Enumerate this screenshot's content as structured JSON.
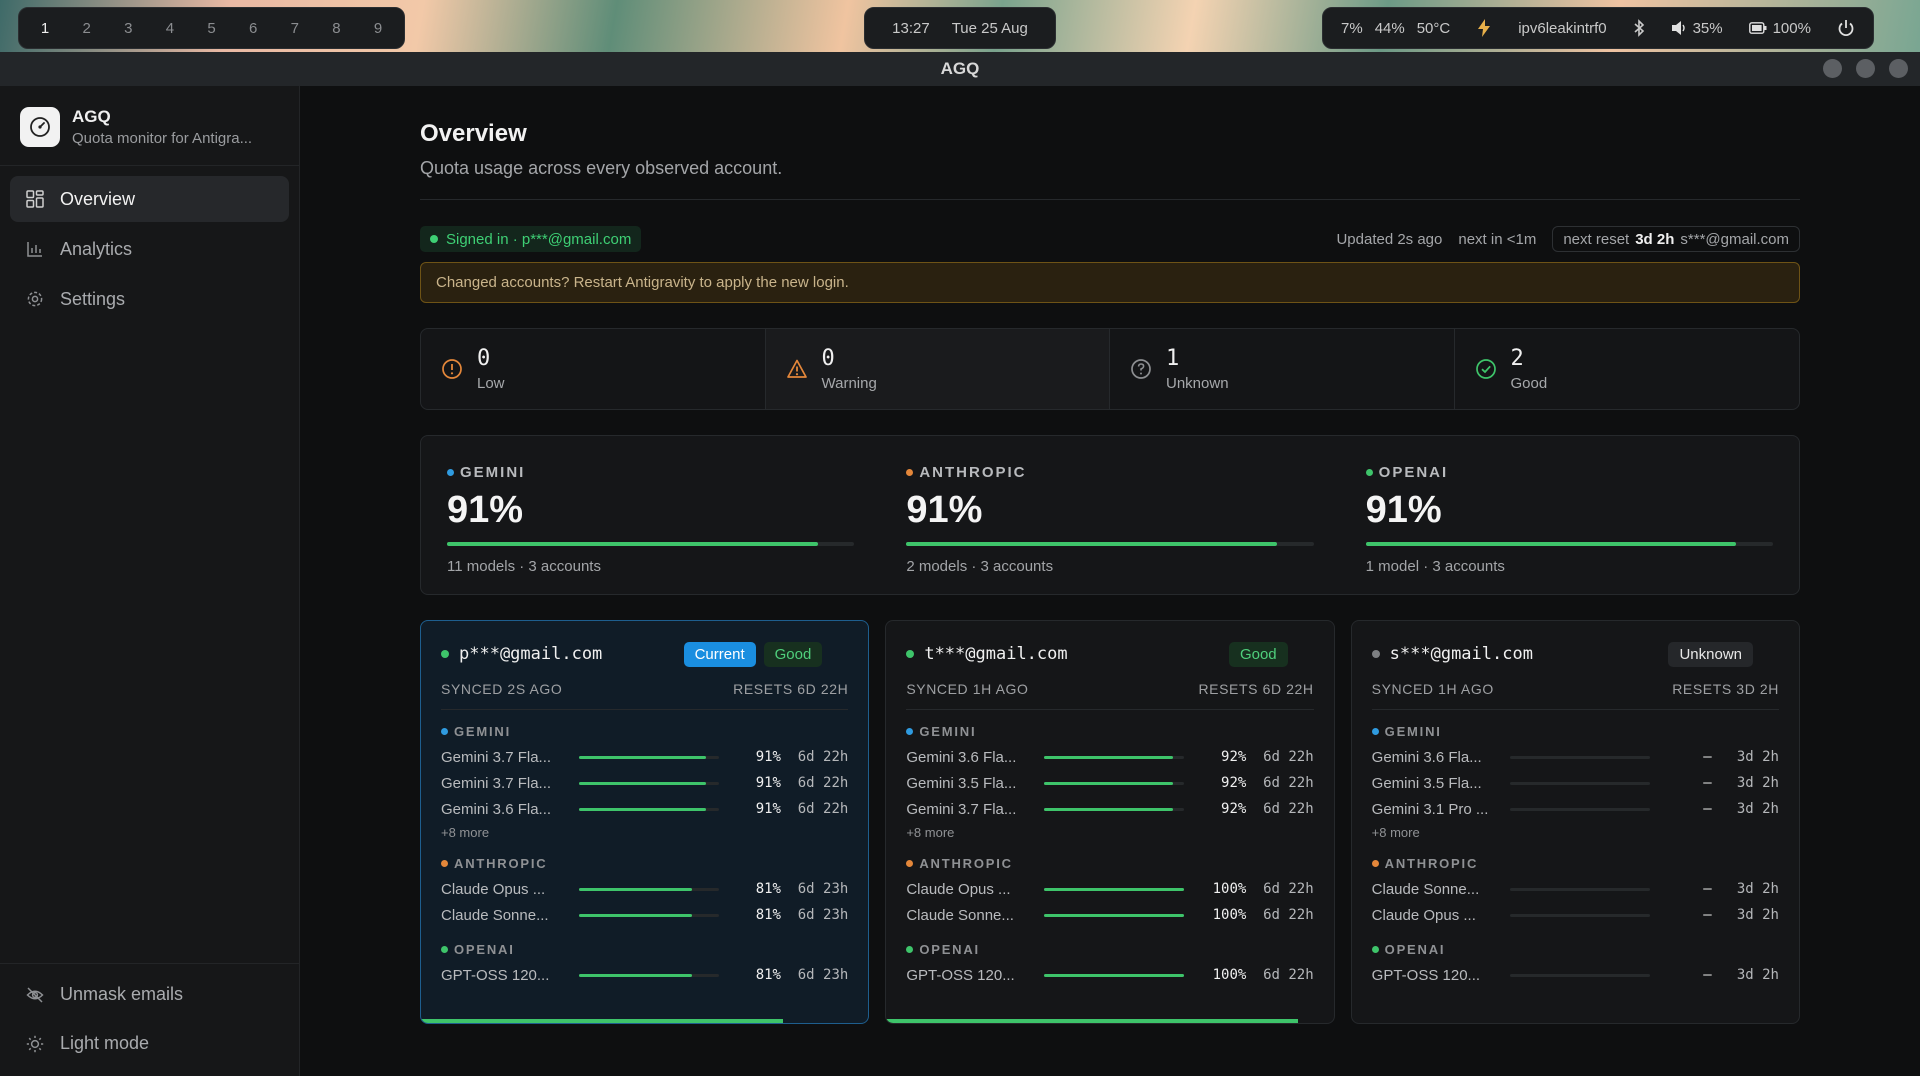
{
  "desktop": {
    "workspaces": [
      "1",
      "2",
      "3",
      "4",
      "5",
      "6",
      "7",
      "8",
      "9"
    ],
    "active_workspace": "1",
    "time": "13:27",
    "date": "Tue 25 Aug",
    "cpu": "7%",
    "mem": "44%",
    "temp": "50°C",
    "network": "ipv6leakintrf0",
    "volume": "35%",
    "battery": "100%"
  },
  "window": {
    "title": "AGQ"
  },
  "sidebar": {
    "app_name": "AGQ",
    "app_sub": "Quota monitor for Antigra...",
    "nav": [
      {
        "label": "Overview",
        "icon": "grid-icon"
      },
      {
        "label": "Analytics",
        "icon": "bar-chart-icon"
      },
      {
        "label": "Settings",
        "icon": "gear-icon"
      }
    ],
    "bottom": [
      {
        "label": "Unmask emails",
        "icon": "eye-off-icon"
      },
      {
        "label": "Light mode",
        "icon": "sun-icon"
      }
    ]
  },
  "header": {
    "title": "Overview",
    "subtitle": "Quota usage across every observed account."
  },
  "status": {
    "signed_in": "Signed in · p***@gmail.com",
    "updated": "Updated 2s ago",
    "next": "next in <1m",
    "next_reset_label": "next reset",
    "next_reset_value": "3d 2h",
    "next_reset_email": "s***@gmail.com"
  },
  "banner": "Changed accounts? Restart Antigravity to apply the new login.",
  "summary": [
    {
      "count": "0",
      "label": "Low",
      "color": "#e4873a"
    },
    {
      "count": "0",
      "label": "Warning",
      "color": "#e4873a"
    },
    {
      "count": "1",
      "label": "Unknown",
      "color": "#8c8e91"
    },
    {
      "count": "2",
      "label": "Good",
      "color": "#3ec46a"
    }
  ],
  "providers": [
    {
      "name": "GEMINI",
      "color": "#2f9be0",
      "pct": "91%",
      "fill": 0.91,
      "meta": "11 models · 3 accounts"
    },
    {
      "name": "ANTHROPIC",
      "color": "#e4873a",
      "pct": "91%",
      "fill": 0.91,
      "meta": "2 models · 3 accounts"
    },
    {
      "name": "OPENAI",
      "color": "#3ec46a",
      "pct": "91%",
      "fill": 0.91,
      "meta": "1 model · 3 accounts"
    }
  ],
  "accounts": [
    {
      "email": "p***@gmail.com",
      "dot_color": "#3ec46a",
      "badges": [
        {
          "text": "Current",
          "kind": "current"
        },
        {
          "text": "Good",
          "kind": "good"
        }
      ],
      "synced": "SYNCED 2S AGO",
      "resets": "RESETS 6D 22H",
      "bottom_fill": 0.81,
      "groups": [
        {
          "name": "GEMINI",
          "color": "#2f9be0",
          "more": "+8 more",
          "models": [
            {
              "name": "Gemini 3.7 Fla...",
              "pct": "91%",
              "fill": 0.91,
              "reset": "6d 22h"
            },
            {
              "name": "Gemini 3.7 Fla...",
              "pct": "91%",
              "fill": 0.91,
              "reset": "6d 22h"
            },
            {
              "name": "Gemini 3.6 Fla...",
              "pct": "91%",
              "fill": 0.91,
              "reset": "6d 22h"
            }
          ]
        },
        {
          "name": "ANTHROPIC",
          "color": "#e4873a",
          "more": "",
          "models": [
            {
              "name": "Claude Opus ...",
              "pct": "81%",
              "fill": 0.81,
              "reset": "6d 23h"
            },
            {
              "name": "Claude Sonne...",
              "pct": "81%",
              "fill": 0.81,
              "reset": "6d 23h"
            }
          ]
        },
        {
          "name": "OPENAI",
          "color": "#3ec46a",
          "more": "",
          "models": [
            {
              "name": "GPT-OSS 120...",
              "pct": "81%",
              "fill": 0.81,
              "reset": "6d 23h"
            }
          ]
        }
      ]
    },
    {
      "email": "t***@gmail.com",
      "dot_color": "#3ec46a",
      "badges": [
        {
          "text": "Good",
          "kind": "good"
        }
      ],
      "synced": "SYNCED 1H AGO",
      "resets": "RESETS 6D 22H",
      "bottom_fill": 0.92,
      "groups": [
        {
          "name": "GEMINI",
          "color": "#2f9be0",
          "more": "+8 more",
          "models": [
            {
              "name": "Gemini 3.6 Fla...",
              "pct": "92%",
              "fill": 0.92,
              "reset": "6d 22h"
            },
            {
              "name": "Gemini 3.5 Fla...",
              "pct": "92%",
              "fill": 0.92,
              "reset": "6d 22h"
            },
            {
              "name": "Gemini 3.7 Fla...",
              "pct": "92%",
              "fill": 0.92,
              "reset": "6d 22h"
            }
          ]
        },
        {
          "name": "ANTHROPIC",
          "color": "#e4873a",
          "more": "",
          "models": [
            {
              "name": "Claude Opus ...",
              "pct": "100%",
              "fill": 1.0,
              "reset": "6d 22h"
            },
            {
              "name": "Claude Sonne...",
              "pct": "100%",
              "fill": 1.0,
              "reset": "6d 22h"
            }
          ]
        },
        {
          "name": "OPENAI",
          "color": "#3ec46a",
          "more": "",
          "models": [
            {
              "name": "GPT-OSS 120...",
              "pct": "100%",
              "fill": 1.0,
              "reset": "6d 22h"
            }
          ]
        }
      ]
    },
    {
      "email": "s***@gmail.com",
      "dot_color": "#7d7f82",
      "badges": [
        {
          "text": "Unknown",
          "kind": "unknown"
        }
      ],
      "synced": "SYNCED 1H AGO",
      "resets": "RESETS 3D 2H",
      "bottom_fill": 0,
      "groups": [
        {
          "name": "GEMINI",
          "color": "#2f9be0",
          "more": "+8 more",
          "models": [
            {
              "name": "Gemini 3.6 Fla...",
              "pct": "–",
              "fill": 0,
              "reset": "3d 2h"
            },
            {
              "name": "Gemini 3.5 Fla...",
              "pct": "–",
              "fill": 0,
              "reset": "3d 2h"
            },
            {
              "name": "Gemini 3.1 Pro ...",
              "pct": "–",
              "fill": 0,
              "reset": "3d 2h"
            }
          ]
        },
        {
          "name": "ANTHROPIC",
          "color": "#e4873a",
          "more": "",
          "models": [
            {
              "name": "Claude Sonne...",
              "pct": "–",
              "fill": 0,
              "reset": "3d 2h"
            },
            {
              "name": "Claude Opus ...",
              "pct": "–",
              "fill": 0,
              "reset": "3d 2h"
            }
          ]
        },
        {
          "name": "OPENAI",
          "color": "#3ec46a",
          "more": "",
          "models": [
            {
              "name": "GPT-OSS 120...",
              "pct": "–",
              "fill": 0,
              "reset": "3d 2h"
            }
          ]
        }
      ]
    }
  ]
}
